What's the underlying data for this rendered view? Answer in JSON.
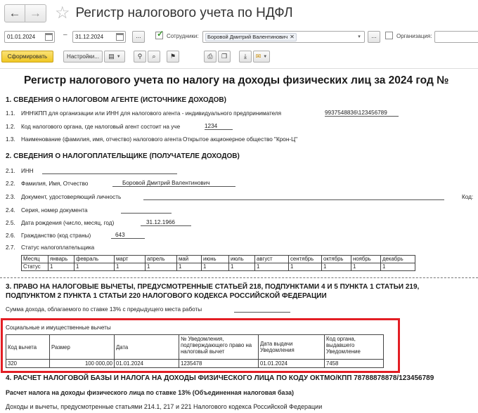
{
  "window": {
    "title": "Регистр налогового учета по НДФЛ"
  },
  "filters": {
    "date_from": "01.01.2024",
    "date_sep": "–",
    "date_to": "31.12.2024",
    "dots": "...",
    "employees_label": "Сотрудники:",
    "employee_tag": "Боровой Дмитрий Валентинович",
    "organization_label": "Организация:"
  },
  "toolbar": {
    "generate": "Сформировать",
    "settings": "Настройки..."
  },
  "report": {
    "title": "Регистр налогового учета по налогу на доходы физических лиц за 2024 год №",
    "s1": {
      "heading": "1. СВЕДЕНИЯ О НАЛОГОВОМ АГЕНТЕ (ИСТОЧНИКЕ ДОХОДОВ)",
      "r1_num": "1.1.",
      "r1_label": "ИНН\\КПП для организации или ИНН для налогового агента -  индивидуального предпринимателя",
      "r1_value": "9937548836\\123456789",
      "r2_num": "1.2.",
      "r2_label": "Код налогового органа, где налоговый агент состоит на уче",
      "r2_value": "1234",
      "r3_num": "1.3.",
      "r3_label": "Наименование (фамилия, имя, отчество) налогового агента",
      "r3_value": "Открытое акционерное общество \"Крон-Ц\""
    },
    "s2": {
      "heading": "2. СВЕДЕНИЯ О НАЛОГОПЛАТЕЛЬЩИКЕ (ПОЛУЧАТЕЛЕ ДОХОДОВ)",
      "r1_num": "2.1.",
      "r1_label": "ИНН",
      "r2_num": "2.2.",
      "r2_label": "Фамилия, Имя, Отчество",
      "r2_value": "Боровой Дмитрий Валентинович",
      "r3_num": "2.3.",
      "r3_label": "Документ, удостоверяющий личность",
      "code_label": "Код:",
      "r4_num": "2.4.",
      "r4_label": "Серия, номер документа",
      "r5_num": "2.5.",
      "r5_label": "Дата рождения (число, месяц, год)",
      "r5_value": "31.12.1966",
      "r6_num": "2.6.",
      "r6_label": "Гражданство (код страны)",
      "r6_value": "643",
      "r7_num": "2.7.",
      "r7_label": "Статус налогоплательщика",
      "months_row": [
        "Месяц",
        "январь",
        "февраль",
        "март",
        "апрель",
        "май",
        "июнь",
        "июль",
        "август",
        "сентябрь",
        "октябрь",
        "ноябрь",
        "декабрь"
      ],
      "status_row": [
        "Статус",
        "1",
        "1",
        "1",
        "1",
        "1",
        "1",
        "1",
        "1",
        "1",
        "1",
        "1",
        "1"
      ]
    },
    "s3": {
      "heading_line1": "3. ПРАВО НА НАЛОГОВЫЕ ВЫЧЕТЫ, ПРЕДУСМОТРЕННЫЕ СТАТЬЕЙ  218, ПОДПУНКТАМИ 4 И 5 ПУНКТА  1 СТАТЬИ 219,",
      "heading_line2": "ПОДПУНКТОМ 2 ПУНКТА 1 СТАТЬИ 220 НАЛОГОВОГО КОДЕКСА РОССИЙСКОЙ ФЕДЕРАЦИИ",
      "prev_income_label": "Сумма дохода, облагаемого по ставке 13% с предыдущего места работы",
      "social_label": "Социальные и имущественные вычеты",
      "columns": [
        "Код вычета",
        "Размер",
        "Дата",
        "№ Уведомления, подтверждающего право на налоговый вычет",
        "Дата выдачи Уведомления",
        "Код органа, выдавшего Уведомление"
      ],
      "row": [
        "320",
        "100 000,00",
        "01.01.2024",
        "1235478",
        "01.01.2024",
        "7458"
      ]
    },
    "s4": {
      "heading": "4. РАСЧЕТ НАЛОГОВОЙ БАЗЫ И НАЛОГА НА ДОХОДЫ ФИЗИЧЕСКОГО ЛИЦА ПО КОДУ ОКТМО/КПП 78788878878/123456789",
      "subheading": "Расчет налога на доходы физического лица по ставке 13% (Объединенная налоговая база)",
      "line": "Доходы и вычеты, предусмотренные статьями 214.1, 217 и 221 Налогового кодекса Российской Федерации"
    }
  }
}
